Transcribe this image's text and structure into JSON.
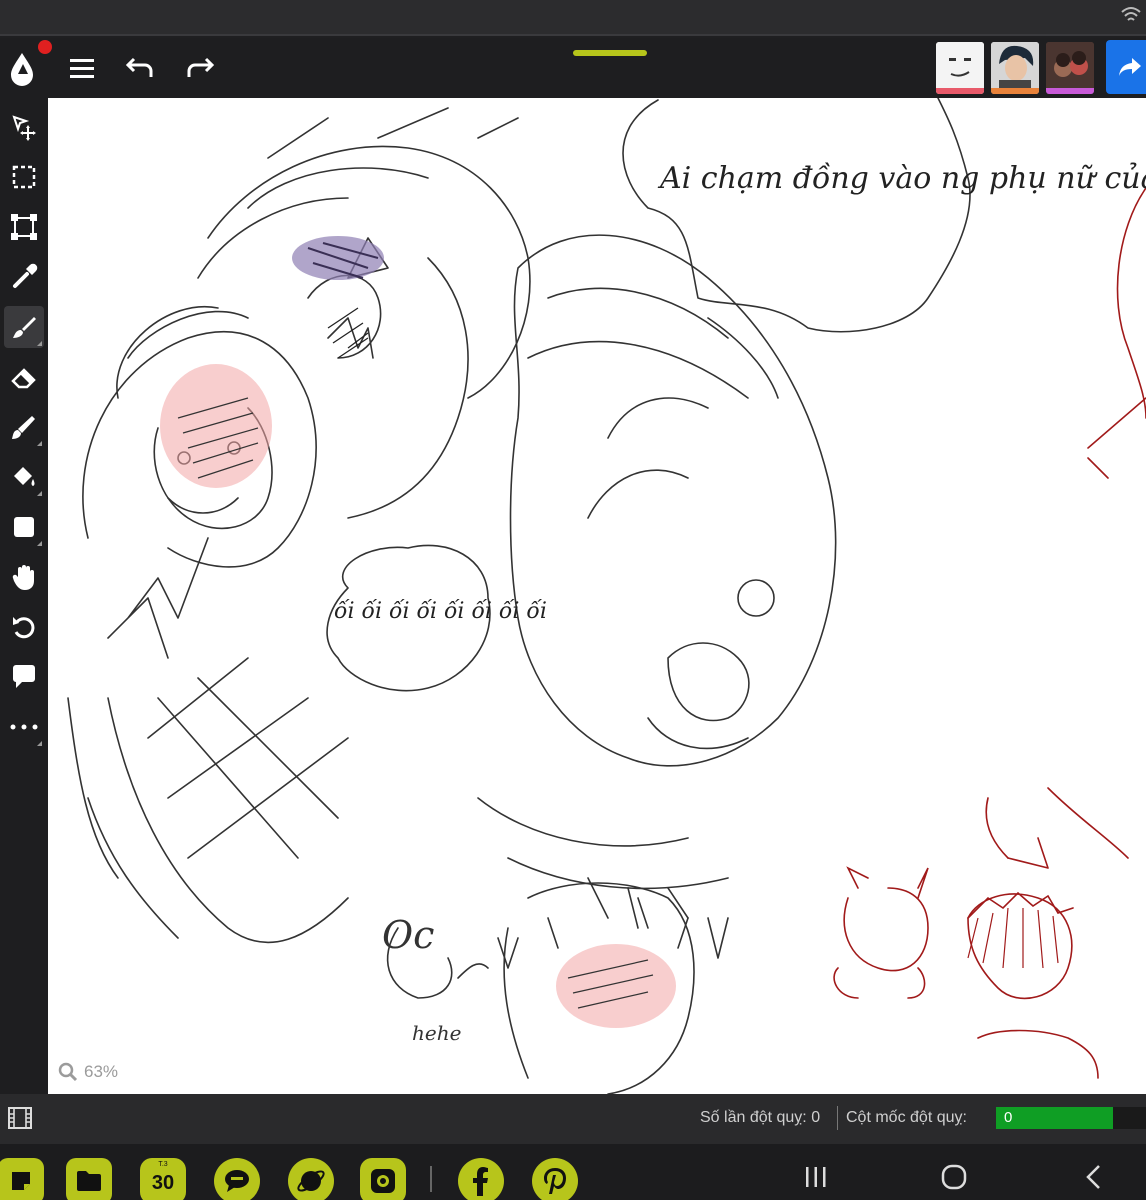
{
  "app": {
    "accent_color": "#b7c51b",
    "share_button_color": "#1a73e8",
    "notification_color": "#e02020"
  },
  "toolbar": {
    "icons": [
      "app-logo-icon",
      "menu-icon",
      "undo-icon",
      "redo-icon"
    ],
    "share_icon": "share-icon"
  },
  "collaborators": [
    {
      "name": "collaborator-1",
      "indicator_color": "#e85a6a"
    },
    {
      "name": "collaborator-2",
      "indicator_color": "#e8823a"
    },
    {
      "name": "collaborator-3",
      "indicator_color": "#c85ad8"
    }
  ],
  "tools": [
    "move-select-icon",
    "marquee-select-icon",
    "transform-icon",
    "eyedropper-icon",
    "brush-icon",
    "eraser-icon",
    "smudge-icon",
    "fill-bucket-icon",
    "shape-icon",
    "hand-icon",
    "rotate-view-icon",
    "comment-icon",
    "more-icon"
  ],
  "active_tool": "brush-icon",
  "canvas": {
    "zoom_label": "63%",
    "speech_bubble_1": "Ai chạm đồng vào ng phụ nữ của tao!",
    "speech_bubble_2": "ối ối ối ối ối ối ối ối",
    "scribble_1": "Oc",
    "scribble_2": "hehe"
  },
  "status": {
    "stroke_count_label": "Số lần đột quỵ: 0",
    "milestone_label": "Cột mốc đột quỵ:",
    "milestone_value": "0",
    "milestone_progress": 0.78
  },
  "dock": {
    "apps": [
      "notes-icon",
      "files-icon",
      "calendar-icon",
      "messages-icon",
      "browser-icon",
      "camera-icon",
      "facebook-icon",
      "pinterest-icon"
    ],
    "calendar_month": "T.3",
    "calendar_day": "30"
  },
  "nav": [
    "recents-icon",
    "home-icon",
    "back-icon"
  ]
}
